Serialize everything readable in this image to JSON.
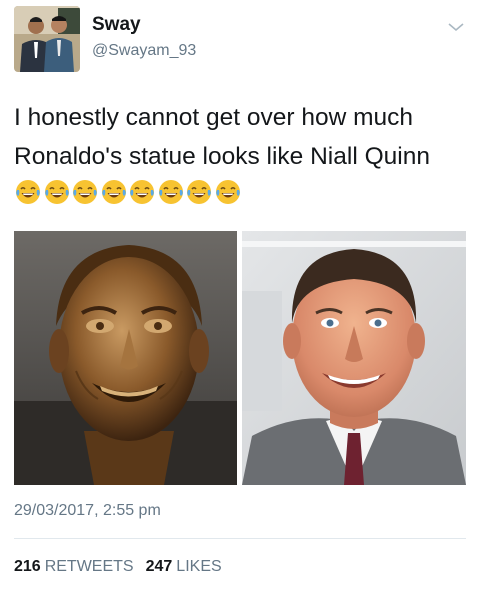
{
  "author": {
    "name": "Sway",
    "handle": "@Swayam_93"
  },
  "tweet": {
    "text": "I honestly cannot get over how much Ronaldo's statue looks like Niall Quinn",
    "emoji_count": 8,
    "emoji_name": "face-with-tears-of-joy"
  },
  "timestamp": "29/03/2017, 2:55 pm",
  "stats": {
    "retweets_count": "216",
    "retweets_label": "RETWEETS",
    "likes_count": "247",
    "likes_label": "LIKES"
  },
  "colors": {
    "text": "#14171a",
    "secondary": "#657786",
    "divider": "#e1e8ed",
    "bronze": "#8a5a2b",
    "suit": "#6b6e72"
  }
}
